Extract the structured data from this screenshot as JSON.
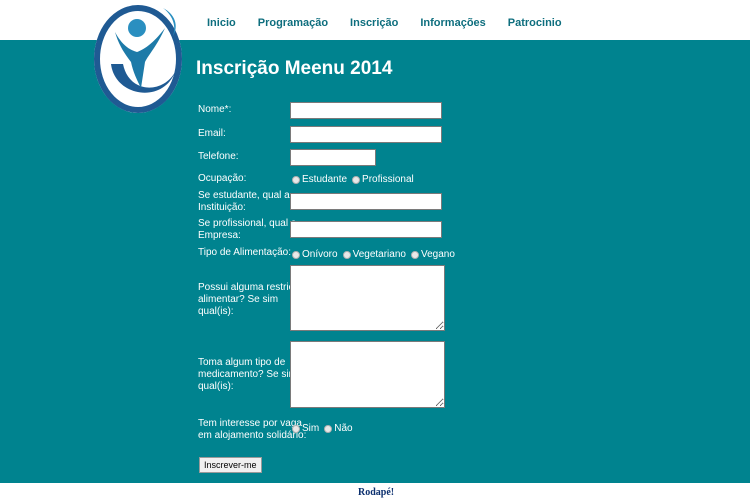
{
  "nav": {
    "items": [
      {
        "label": "Inicio"
      },
      {
        "label": "Programação"
      },
      {
        "label": "Inscrição"
      },
      {
        "label": "Informações"
      },
      {
        "label": "Patrocinio"
      }
    ]
  },
  "logo": {
    "icon": "person-swoosh-logo",
    "colors": {
      "ring": "#1f5a93",
      "figure": "#1d7aa8",
      "accent": "#2a8fc0"
    }
  },
  "page": {
    "title": "Inscrição Meenu 2014"
  },
  "colors": {
    "background": "#00838f",
    "nav_text": "#0e6e7e",
    "footer_text": "#0b2f6e"
  },
  "form": {
    "nome_label": "Nome*:",
    "nome_value": "",
    "email_label": "Email:",
    "email_value": "",
    "telefone_label": "Telefone:",
    "telefone_value": "",
    "ocupacao_label": "Ocupação:",
    "ocupacao_options": [
      "Estudante",
      "Profissional"
    ],
    "instituicao_label_1": "Se estudante, qual a",
    "instituicao_label_2": "Instituição:",
    "instituicao_value": "",
    "empresa_label_1": "Se profissional, qual a",
    "empresa_label_2": "Empresa:",
    "empresa_value": "",
    "alimentacao_label": "Tipo de Alimentação:",
    "alimentacao_options": [
      "Onívoro",
      "Vegetariano",
      "Vegano"
    ],
    "restricao_label_1": "Possui alguma restrição",
    "restricao_label_2": "alimentar? Se sim",
    "restricao_label_3": "qual(is):",
    "restricao_value": "",
    "medicamento_label_1": "Toma algum tipo de",
    "medicamento_label_2": "medicamento? Se sim",
    "medicamento_label_3": "qual(is):",
    "medicamento_value": "",
    "alojamento_label_1": "Tem interesse por vaga",
    "alojamento_label_2": "em alojamento solidário:",
    "alojamento_options": [
      "Sim",
      "Não"
    ],
    "submit_label": "Inscrever-me"
  },
  "footer": {
    "text": "Rodapé!"
  }
}
